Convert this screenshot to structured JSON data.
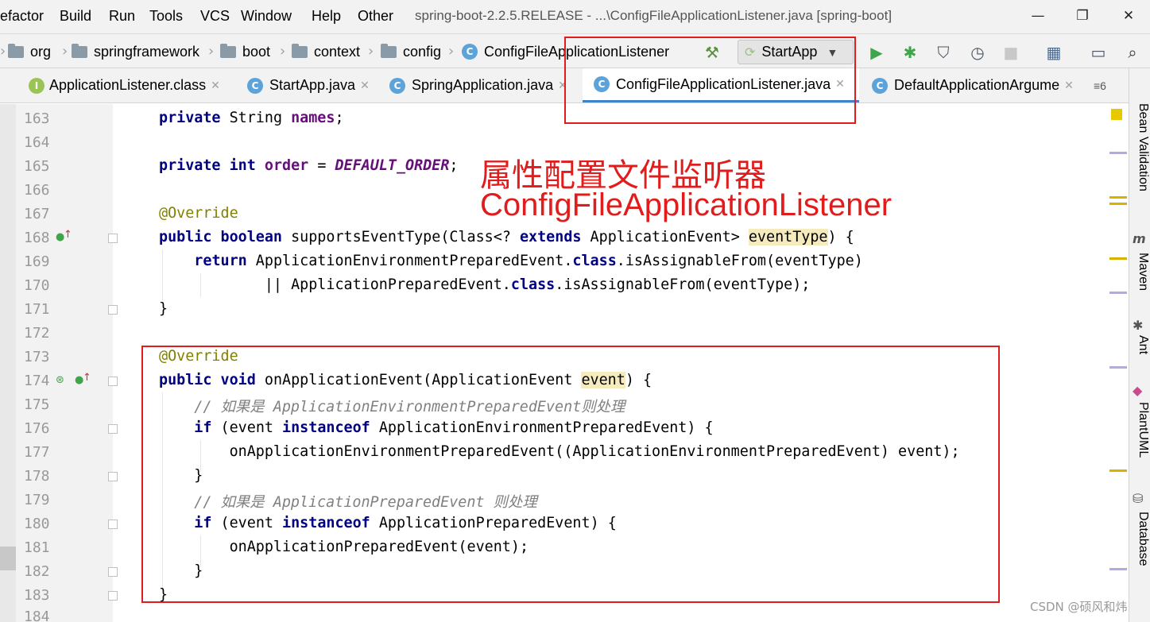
{
  "menu": {
    "items": [
      "efactor",
      "Build",
      "Run",
      "Tools",
      "VCS",
      "Window",
      "Help",
      "Other"
    ],
    "window_title": "spring-boot-2.2.5.RELEASE - ...\\ConfigFileApplicationListener.java [spring-boot]",
    "controls": [
      "—",
      "❐",
      "✕"
    ]
  },
  "breadcrumbs": [
    "org",
    "springframework",
    "boot",
    "context",
    "config",
    "ConfigFileApplicationListener"
  ],
  "toolbar": {
    "build_icon": "hammer-icon",
    "run_config": "StartApp",
    "icons": [
      "run-icon",
      "debug-icon",
      "coverage-icon",
      "profile-icon",
      "stop-icon",
      "project-structure-icon",
      "frame-icon",
      "search-icon"
    ]
  },
  "tabs": [
    {
      "label": "ApplicationListener.class",
      "icon": "I",
      "active": false
    },
    {
      "label": "StartApp.java",
      "icon": "C",
      "active": false
    },
    {
      "label": "SpringApplication.java",
      "icon": "C",
      "active": false
    },
    {
      "label": "ConfigFileApplicationListener.java",
      "icon": "C",
      "active": true
    },
    {
      "label": "DefaultApplicationArgume",
      "icon": "C",
      "active": false
    }
  ],
  "tab_overflow": "≡6",
  "line_numbers": [
    "163",
    "164",
    "165",
    "166",
    "167",
    "168",
    "169",
    "170",
    "171",
    "172",
    "173",
    "174",
    "175",
    "176",
    "177",
    "178",
    "179",
    "180",
    "181",
    "182",
    "183",
    "184"
  ],
  "annotation": {
    "line1": "属性配置文件监听器",
    "line2": "ConfigFileApplicationListener"
  },
  "right_panel": [
    "Bean Validation",
    "Maven",
    "Ant",
    "PlantUML",
    "Database"
  ],
  "watermark": "CSDN @硕风和炜",
  "colors": {
    "keyword": "#000080",
    "annotation": "#808000",
    "comment": "#808080",
    "field": "#660e7a",
    "highlight": "#f6ebbc",
    "red_box": "#e11c1c",
    "tab_underline": "#4083c9"
  }
}
